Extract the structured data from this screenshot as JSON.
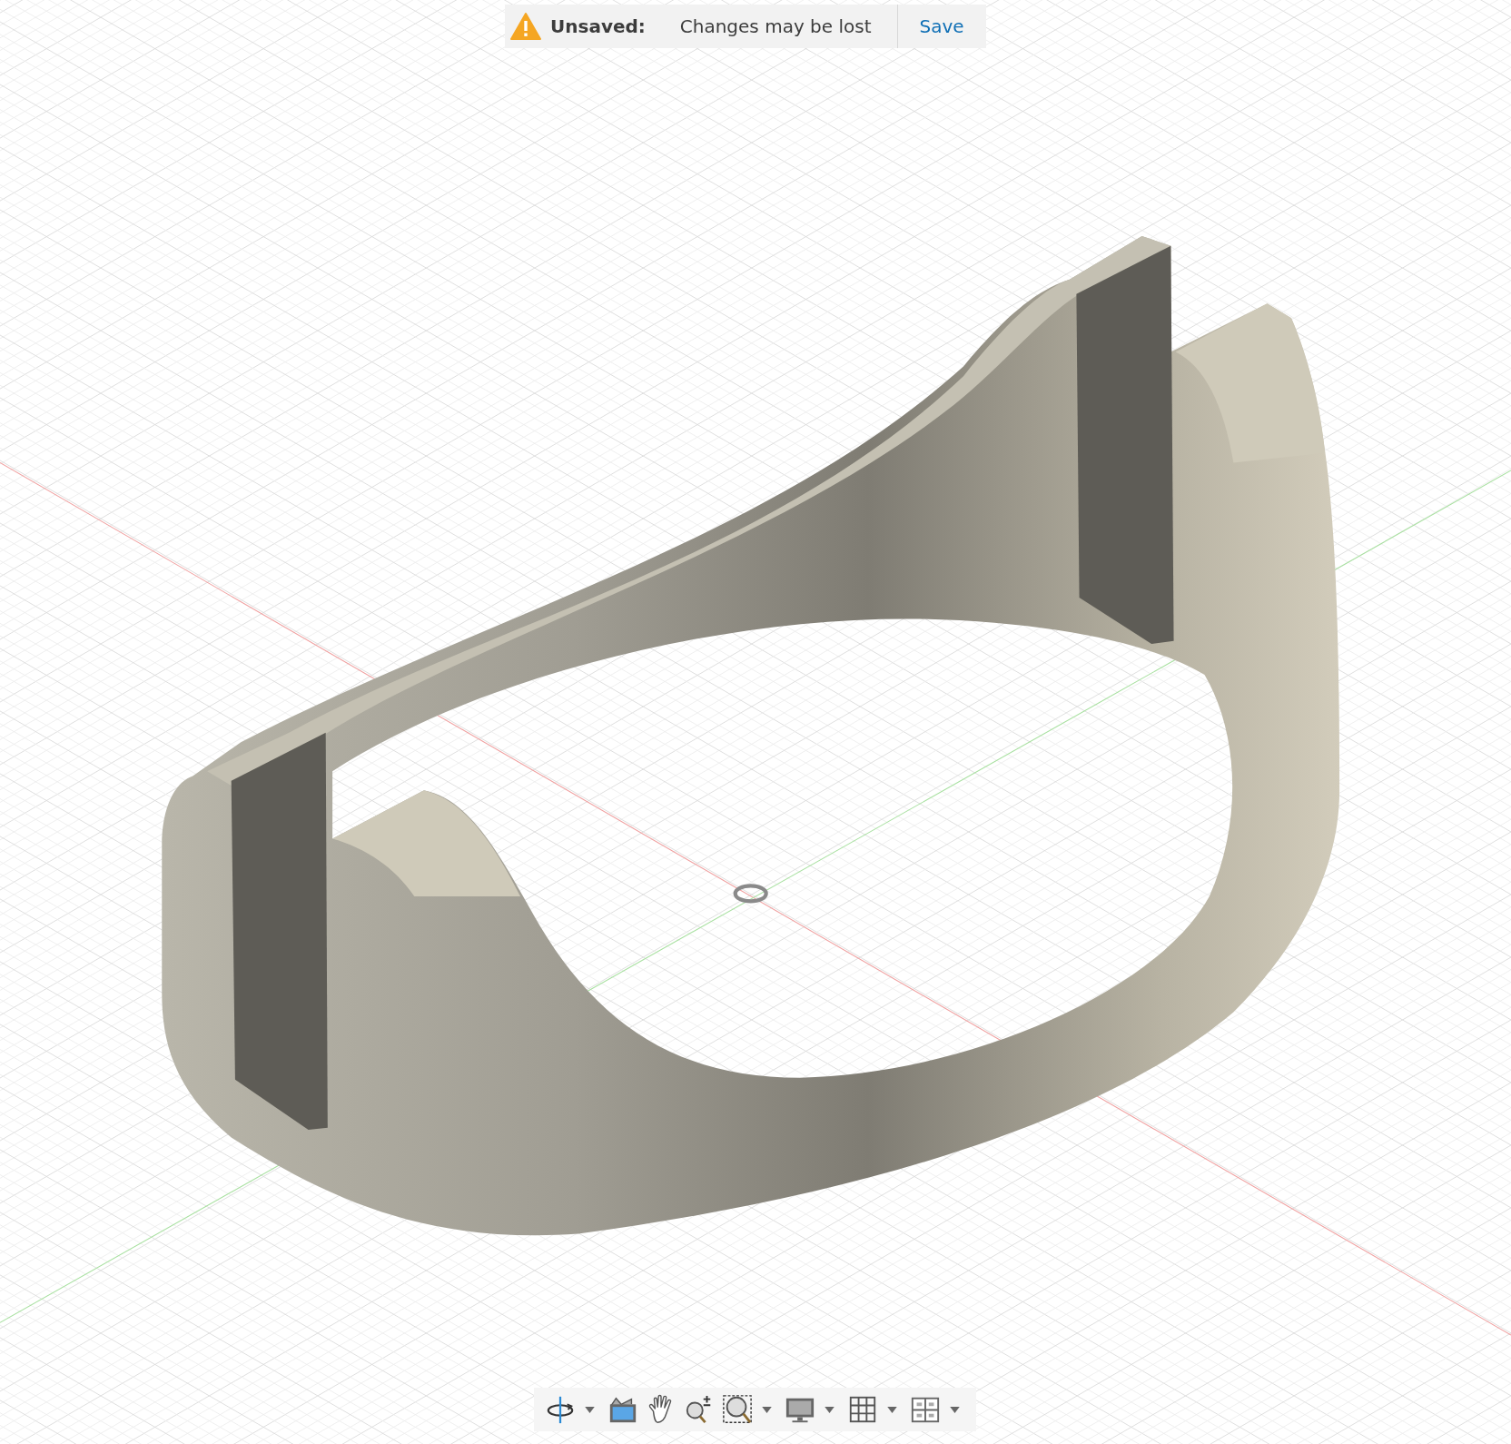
{
  "notification": {
    "label": "Unsaved:",
    "message": "Changes may be lost",
    "action": "Save"
  },
  "toolbar": {
    "tools": [
      {
        "kind": "orbit",
        "dropdown": true
      },
      {
        "kind": "look_at",
        "dropdown": false
      },
      {
        "kind": "pan",
        "dropdown": false
      },
      {
        "kind": "zoom",
        "dropdown": false
      },
      {
        "kind": "fit",
        "dropdown": true
      },
      {
        "kind": "display",
        "dropdown": true
      },
      {
        "kind": "grid",
        "dropdown": true
      },
      {
        "kind": "viewports",
        "dropdown": true
      }
    ]
  }
}
